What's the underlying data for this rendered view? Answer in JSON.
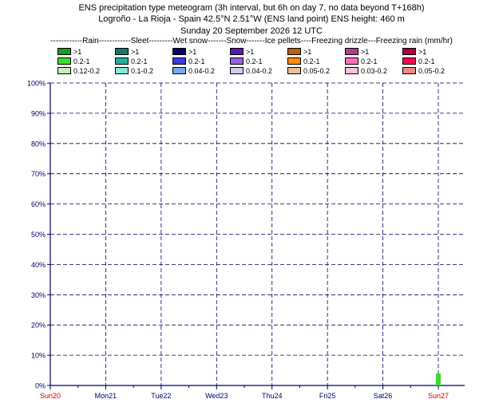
{
  "header": {
    "line1": "ENS precipitation type meteogram (3h interval, but 6h on day 7, no data beyond T+168h)",
    "line2": "Logroño - La Rioja - Spain 42.5°N 2.51°W (ENS land point) ENS height: 460 m",
    "line3": "Sunday 20 September 2026 12 UTC"
  },
  "legend": {
    "header": "------------Rain------------Sleet---------Wet snow-------Snow-------Ice pellets----Freezing drizzle---Freezing rain (mm/hr)",
    "columns": [
      {
        "type": "Rain",
        "entries": [
          {
            "label": ">1",
            "color": "#1a9b1a"
          },
          {
            "label": "0.2-1",
            "color": "#3ddc2a"
          },
          {
            "label": "0.12-0.2",
            "color": "#c8f0b8"
          }
        ]
      },
      {
        "type": "Sleet",
        "entries": [
          {
            "label": ">1",
            "color": "#127a6a"
          },
          {
            "label": "0.2-1",
            "color": "#20b09a"
          },
          {
            "label": "0.1-0.2",
            "color": "#80e8d8"
          }
        ]
      },
      {
        "type": "Wet snow",
        "entries": [
          {
            "label": ">1",
            "color": "#000066"
          },
          {
            "label": "0.2-1",
            "color": "#3a3ae8"
          },
          {
            "label": "0.04-0.2",
            "color": "#7aa8f0"
          }
        ]
      },
      {
        "type": "Snow",
        "entries": [
          {
            "label": ">1",
            "color": "#5a1ab0"
          },
          {
            "label": "0.2-1",
            "color": "#9a60e0"
          },
          {
            "label": "0.04-0.2",
            "color": "#d8c8f0"
          }
        ]
      },
      {
        "type": "Ice pellets",
        "entries": [
          {
            "label": ">1",
            "color": "#b8600a"
          },
          {
            "label": "0.2-1",
            "color": "#ff8a00"
          },
          {
            "label": "0.05-0.2",
            "color": "#e8c090"
          }
        ]
      },
      {
        "type": "Freezing drizzle",
        "entries": [
          {
            "label": ">1",
            "color": "#b04088"
          },
          {
            "label": "0.2-1",
            "color": "#ff70c0"
          },
          {
            "label": "0.03-0.2",
            "color": "#ffc0e0"
          }
        ]
      },
      {
        "type": "Freezing rain",
        "entries": [
          {
            "label": ">1",
            "color": "#b00040"
          },
          {
            "label": "0.2-1",
            "color": "#ff0050"
          },
          {
            "label": "0.05-0.2",
            "color": "#f08888"
          }
        ]
      }
    ]
  },
  "chart_data": {
    "type": "bar",
    "ylabel": "",
    "ylim": [
      0,
      100
    ],
    "yticks": [
      "0%",
      "10%",
      "20%",
      "30%",
      "40%",
      "50%",
      "60%",
      "70%",
      "80%",
      "90%",
      "100%"
    ],
    "xrange_hours": [
      0,
      168
    ],
    "xticks": [
      {
        "label": "Sun20",
        "hour": 0,
        "weekend": true
      },
      {
        "label": "Mon21",
        "hour": 24,
        "weekend": false
      },
      {
        "label": "Tue22",
        "hour": 48,
        "weekend": false
      },
      {
        "label": "Wed23",
        "hour": 72,
        "weekend": false
      },
      {
        "label": "Thu24",
        "hour": 96,
        "weekend": false
      },
      {
        "label": "Fri25",
        "hour": 120,
        "weekend": false
      },
      {
        "label": "Sat26",
        "hour": 144,
        "weekend": false
      },
      {
        "label": "Sun27",
        "hour": 168,
        "weekend": true
      }
    ],
    "grid": true,
    "bars": [
      {
        "hour": 168,
        "value": 4,
        "category": "Rain 0.2-1",
        "color": "#3ddc2a"
      }
    ],
    "colors": {
      "axis": "#000066",
      "grid": "#000066",
      "weekend_label": "#cc0000"
    }
  }
}
